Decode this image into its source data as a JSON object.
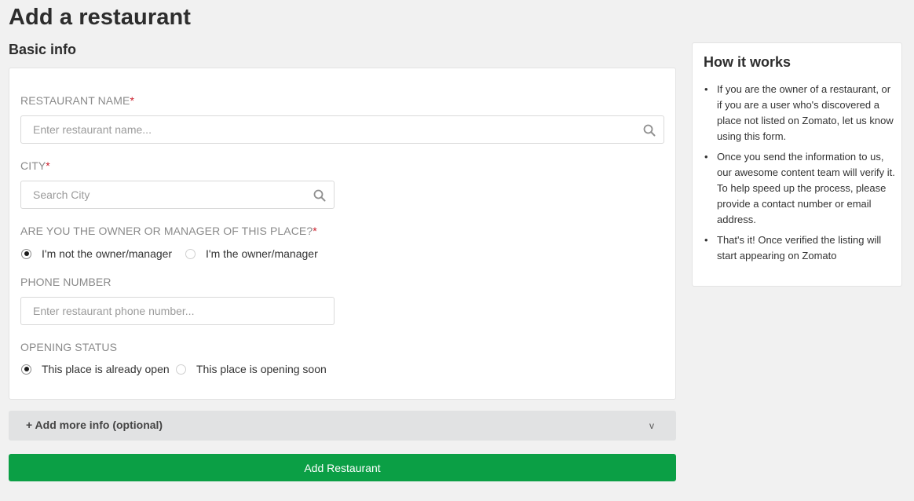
{
  "page": {
    "title": "Add a restaurant"
  },
  "basic_info": {
    "title": "Basic info",
    "restaurant_name": {
      "label": "RESTAURANT NAME",
      "required_mark": "*",
      "placeholder": "Enter restaurant name...",
      "value": "",
      "icon": "search-icon"
    },
    "city": {
      "label": "CITY",
      "required_mark": "*",
      "placeholder": "Search City",
      "value": "",
      "icon": "search-icon"
    },
    "owner": {
      "label": "ARE YOU THE OWNER OR MANAGER OF THIS PLACE?",
      "required_mark": "*",
      "options": [
        {
          "label": "I'm not the owner/manager",
          "checked": true
        },
        {
          "label": "I'm the owner/manager",
          "checked": false
        }
      ]
    },
    "phone": {
      "label": "PHONE NUMBER",
      "placeholder": "Enter restaurant phone number...",
      "value": ""
    },
    "opening_status": {
      "label": "OPENING STATUS",
      "options": [
        {
          "label": "This place is already open",
          "checked": true
        },
        {
          "label": "This place is opening soon",
          "checked": false
        }
      ]
    }
  },
  "more_info": {
    "label": "+ Add more info (optional)",
    "chevron": "v",
    "icon": "chevron-down-icon"
  },
  "submit": {
    "label": "Add Restaurant"
  },
  "how_it_works": {
    "title": "How it works",
    "bullet": "•",
    "items": [
      "If you are the owner of a restaurant, or if you are a user who's discovered a place not listed on Zomato, let us know using this form.",
      "Once you send the information to us, our awesome content team will verify it. To help speed up the process, please provide a contact number or email address.",
      "That's it! Once verified the listing will start appearing on Zomato"
    ]
  },
  "colors": {
    "accent_green": "#0b9f45",
    "required_red": "#cb202d",
    "page_background": "#f1f1f1"
  }
}
